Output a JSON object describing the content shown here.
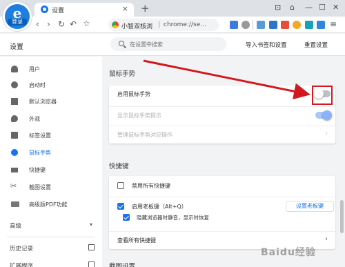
{
  "browser": {
    "logo_letter": "e",
    "logo_login": "登录",
    "tab_title": "设置",
    "tab_close": "×",
    "new_tab": "+",
    "window_controls": [
      "⊡",
      "⌂",
      "—",
      "☐",
      "✕"
    ],
    "nav": [
      "‹",
      "›",
      "↻",
      "↶",
      "☆"
    ],
    "site_name": "小智双核浏",
    "url": "chrome://se..."
  },
  "header": {
    "title": "设置",
    "search_placeholder": "在设置中搜索",
    "import_label": "导入书签和设置",
    "reset_label": "重置设置"
  },
  "sidebar": {
    "items": [
      {
        "label": "用户",
        "icon": "person-icon"
      },
      {
        "label": "启动时",
        "icon": "power-icon"
      },
      {
        "label": "默认浏览器",
        "icon": "browser-icon"
      },
      {
        "label": "外观",
        "icon": "palette-icon"
      },
      {
        "label": "标签设置",
        "icon": "tab-icon"
      },
      {
        "label": "鼠标手势",
        "icon": "mouse-icon"
      },
      {
        "label": "快捷键",
        "icon": "keyboard-icon"
      },
      {
        "label": "截图设置",
        "icon": "scissors-icon"
      },
      {
        "label": "高级版PDF功能",
        "icon": "pdf-icon"
      }
    ],
    "active_index": 5,
    "advanced": "高级",
    "advanced_arrow": "▾",
    "history": "历史记录",
    "extensions": "扩展程序"
  },
  "mouse_gesture": {
    "section_title": "鼠标手势",
    "enable_label": "启用鼠标手势",
    "enable_on": false,
    "hint_label": "显示鼠标手势提示",
    "hint_on": true,
    "manage_label": "管理鼠标手势对应操作",
    "manage_arrow": "›"
  },
  "shortcuts": {
    "section_title": "快捷键",
    "disable_all_label": "禁用所有快捷键",
    "boss_key_label": "启用老板键（Alt+Q）",
    "boss_key_button": "设置老板键",
    "mute_label": "隐藏浏览器时静音，显示时恢复",
    "view_all_label": "查看所有快捷键",
    "view_all_arrow": "›"
  },
  "next_section_title": "截图设置",
  "watermark": "Baidu经验",
  "colors": {
    "accent": "#1a73e8",
    "highlight": "#d2191f"
  }
}
